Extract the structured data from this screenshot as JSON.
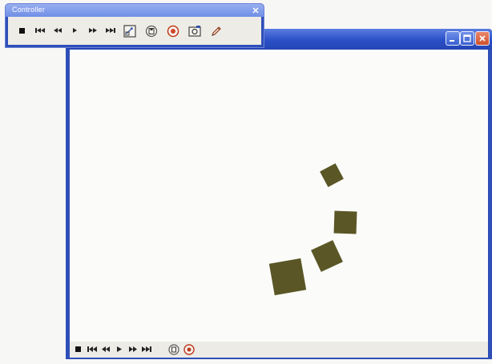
{
  "controller_toolbar": {
    "title": "Controller",
    "buttons": [
      "stop-icon",
      "go-to-start-icon",
      "rewind-icon",
      "play-icon",
      "fast-forward-icon",
      "go-to-end-icon",
      "settings-icon",
      "save-icon",
      "record-icon",
      "camera-icon",
      "edit-icon"
    ]
  },
  "viewer_window": {
    "title": "",
    "title_buttons": [
      "minimize-icon",
      "maximize-icon",
      "close-icon"
    ],
    "bottom_controls": [
      "stop-icon",
      "go-to-start-icon",
      "rewind-icon",
      "play-icon",
      "fast-forward-icon",
      "go-to-end-icon",
      "save-icon",
      "record-icon"
    ],
    "colors": {
      "titlebar": "#2b4fc7",
      "canvas": "#fbfbfa",
      "square_fill": "#5a5626"
    }
  }
}
